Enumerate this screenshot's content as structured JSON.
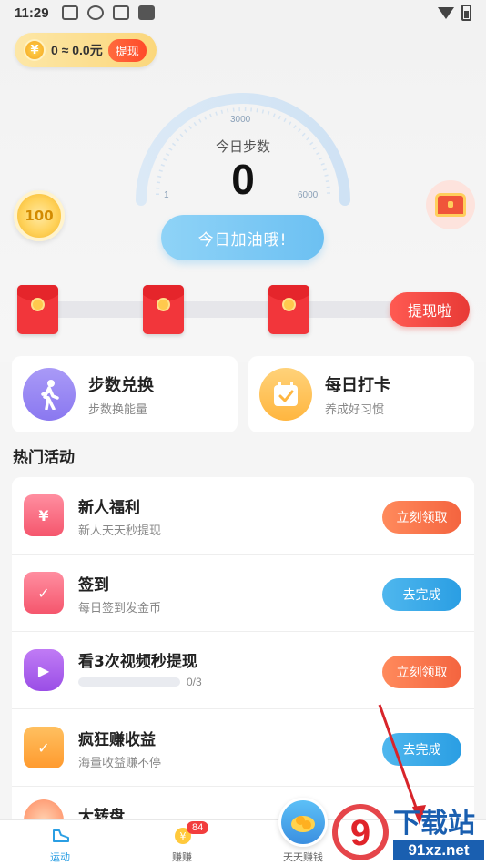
{
  "status_bar": {
    "time": "11:29"
  },
  "header": {
    "coin_icon_text": "¥",
    "balance_text": "0 ≈ 0.0元",
    "withdraw_label": "提现"
  },
  "gauge": {
    "title": "今日步数",
    "steps": "0",
    "tick_min": "1",
    "tick_mid": "3000",
    "tick_max": "6000"
  },
  "coin_reward_label": "100",
  "cheer_button_label": "今日加油哦!",
  "redpacket_withdraw_label": "提现啦",
  "features": [
    {
      "title": "步数兑换",
      "subtitle": "步数换能量"
    },
    {
      "title": "每日打卡",
      "subtitle": "养成好习惯"
    }
  ],
  "section_title": "热门活动",
  "activities": [
    {
      "title": "新人福利",
      "subtitle": "新人天天秒提现",
      "button": "立刻领取"
    },
    {
      "title": "签到",
      "subtitle": "每日签到发金币",
      "button": "去完成"
    },
    {
      "title": "看3次视频秒提现",
      "progress_text": "0/3",
      "progress": 0,
      "button": "立刻领取"
    },
    {
      "title": "疯狂赚收益",
      "subtitle": "海量收益赚不停",
      "button": "去完成"
    },
    {
      "title": "大转盘"
    }
  ],
  "tabbar": {
    "tabs": [
      {
        "label": "运动"
      },
      {
        "label": "赚赚"
      },
      {
        "label": "天天赚钱"
      }
    ],
    "badge_count": "84"
  },
  "watermark": {
    "main": "下载站",
    "domain": "91xz.net",
    "digit": "9"
  },
  "colors": {
    "accent_blue": "#2a9ee3",
    "accent_orange": "#f4643f",
    "red": "#f2363b"
  }
}
